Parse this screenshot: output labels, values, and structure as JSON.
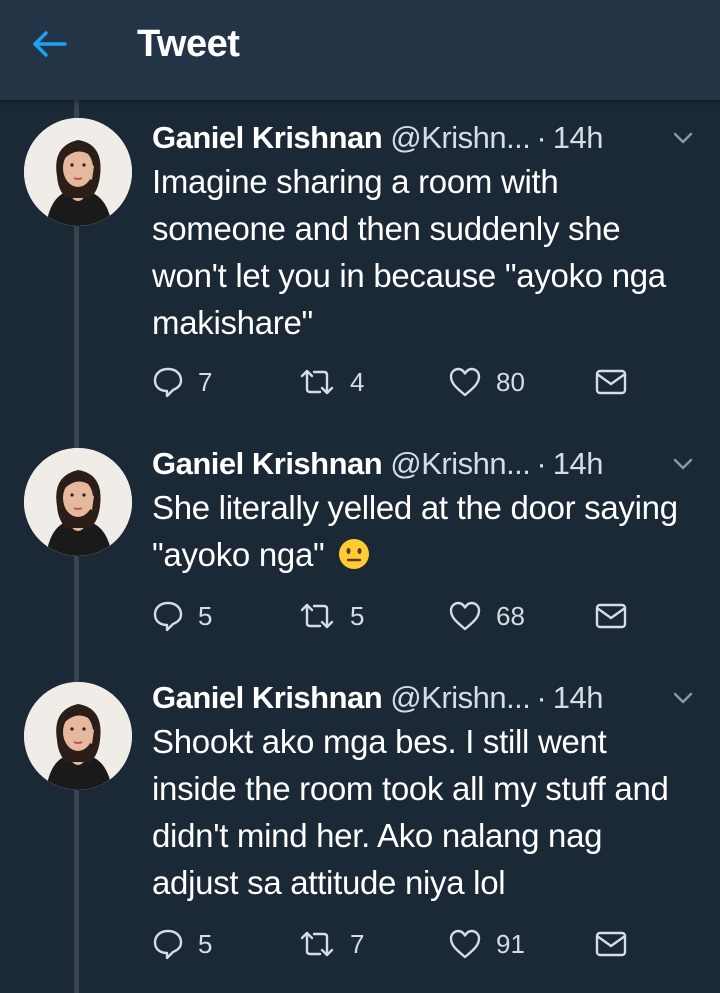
{
  "header": {
    "title": "Tweet",
    "back_icon": "arrow-left-icon",
    "accent_color": "#1da1f2"
  },
  "tweets": [
    {
      "name": "Ganiel Krishnan",
      "handle": "@Krishn...",
      "separator": "·",
      "time": "14h",
      "text": "Imagine sharing a room with someone and then suddenly she won't let you in because \"ayoko nga makishare\"",
      "replies": "7",
      "retweets": "4",
      "likes": "80"
    },
    {
      "name": "Ganiel Krishnan",
      "handle": "@Krishn...",
      "separator": "·",
      "time": "14h",
      "text": "She literally yelled at the door saying \"ayoko nga\"",
      "emoji": "neutral-face-emoji",
      "replies": "5",
      "retweets": "5",
      "likes": "68"
    },
    {
      "name": "Ganiel Krishnan",
      "handle": "@Krishn...",
      "separator": "·",
      "time": "14h",
      "text": "Shookt ako mga bes. I still went inside the room took all my stuff and didn't mind her. Ako nalang nag adjust sa attitude niya lol",
      "replies": "5",
      "retweets": "7",
      "likes": "91"
    }
  ],
  "colors": {
    "background": "#1b2836",
    "topbar": "#243447",
    "thread_line": "#38444d",
    "secondary_text": "#d4dde6"
  }
}
